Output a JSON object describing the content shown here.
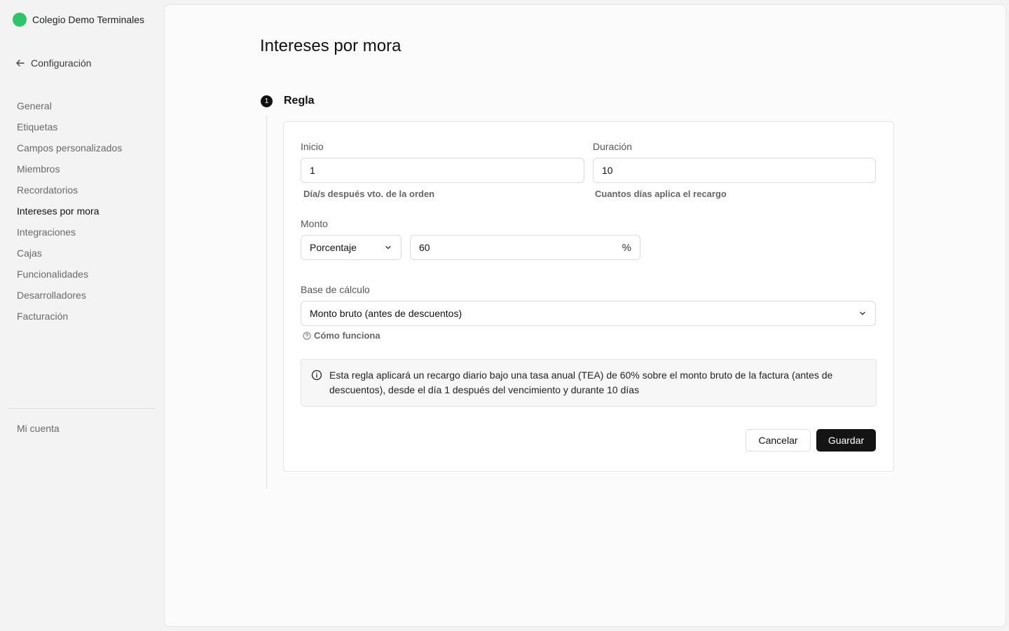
{
  "sidebar": {
    "org_name": "Colegio Demo Terminales",
    "back_label": "Configuración",
    "items": [
      {
        "label": "General"
      },
      {
        "label": "Etiquetas"
      },
      {
        "label": "Campos personalizados"
      },
      {
        "label": "Miembros"
      },
      {
        "label": "Recordatorios"
      },
      {
        "label": "Intereses por mora"
      },
      {
        "label": "Integraciones"
      },
      {
        "label": "Cajas"
      },
      {
        "label": "Funcionalidades"
      },
      {
        "label": "Desarrolladores"
      },
      {
        "label": "Facturación"
      }
    ],
    "active_item": "Intereses por mora",
    "account_label": "Mi cuenta"
  },
  "page": {
    "title": "Intereses por mora"
  },
  "rule": {
    "step_number": "1",
    "step_title": "Regla",
    "inicio": {
      "label": "Inicio",
      "value": "1",
      "hint": "Día/s después vto. de la orden"
    },
    "duracion": {
      "label": "Duración",
      "value": "10",
      "hint": "Cuantos días aplica el recargo"
    },
    "monto": {
      "label": "Monto",
      "type_value": "Porcentaje",
      "amount_value": "60",
      "suffix": "%"
    },
    "base": {
      "label": "Base de cálculo",
      "value": "Monto bruto (antes de descuentos)",
      "howto_label": "Cómo funciona"
    },
    "info_text": "Esta regla aplicará un recargo diario bajo una tasa anual (TEA) de 60% sobre el monto bruto de la factura (antes de descuentos), desde el día 1 después del vencimiento y durante 10 días",
    "cancel_label": "Cancelar",
    "save_label": "Guardar"
  },
  "colors": {
    "brand": "#2fc46b",
    "primary_button": "#141414"
  }
}
